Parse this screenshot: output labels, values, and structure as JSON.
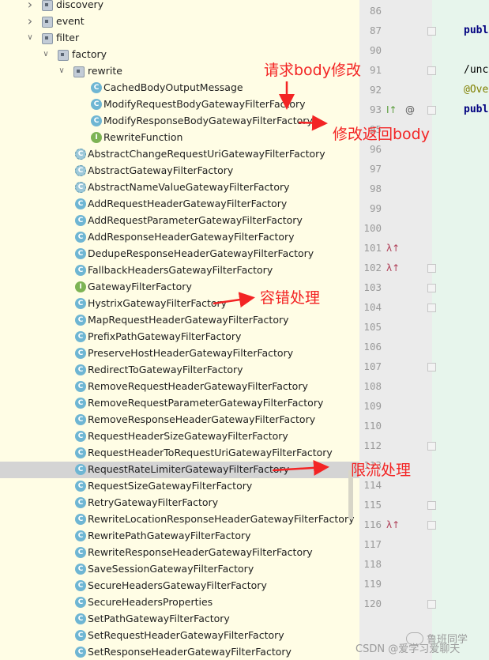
{
  "tree": {
    "items": [
      {
        "label": "discovery",
        "kind": "folder",
        "expanded": false
      },
      {
        "label": "event",
        "kind": "folder",
        "expanded": false
      },
      {
        "label": "filter",
        "kind": "folder",
        "expanded": true
      },
      {
        "label": "factory",
        "kind": "folder",
        "expanded": true
      },
      {
        "label": "rewrite",
        "kind": "folder",
        "expanded": true
      },
      {
        "label": "CachedBodyOutputMessage",
        "kind": "class"
      },
      {
        "label": "ModifyRequestBodyGatewayFilterFactory",
        "kind": "class"
      },
      {
        "label": "ModifyResponseBodyGatewayFilterFactory",
        "kind": "class"
      },
      {
        "label": "RewriteFunction",
        "kind": "interface"
      },
      {
        "label": "AbstractChangeRequestUriGatewayFilterFactory",
        "kind": "abstract"
      },
      {
        "label": "AbstractGatewayFilterFactory",
        "kind": "abstract"
      },
      {
        "label": "AbstractNameValueGatewayFilterFactory",
        "kind": "abstract"
      },
      {
        "label": "AddRequestHeaderGatewayFilterFactory",
        "kind": "class"
      },
      {
        "label": "AddRequestParameterGatewayFilterFactory",
        "kind": "class"
      },
      {
        "label": "AddResponseHeaderGatewayFilterFactory",
        "kind": "class"
      },
      {
        "label": "DedupeResponseHeaderGatewayFilterFactory",
        "kind": "class"
      },
      {
        "label": "FallbackHeadersGatewayFilterFactory",
        "kind": "class"
      },
      {
        "label": "GatewayFilterFactory",
        "kind": "interface"
      },
      {
        "label": "HystrixGatewayFilterFactory",
        "kind": "class"
      },
      {
        "label": "MapRequestHeaderGatewayFilterFactory",
        "kind": "class"
      },
      {
        "label": "PrefixPathGatewayFilterFactory",
        "kind": "class"
      },
      {
        "label": "PreserveHostHeaderGatewayFilterFactory",
        "kind": "class"
      },
      {
        "label": "RedirectToGatewayFilterFactory",
        "kind": "class"
      },
      {
        "label": "RemoveRequestHeaderGatewayFilterFactory",
        "kind": "class"
      },
      {
        "label": "RemoveRequestParameterGatewayFilterFactory",
        "kind": "class"
      },
      {
        "label": "RemoveResponseHeaderGatewayFilterFactory",
        "kind": "class"
      },
      {
        "label": "RequestHeaderSizeGatewayFilterFactory",
        "kind": "class"
      },
      {
        "label": "RequestHeaderToRequestUriGatewayFilterFactory",
        "kind": "class"
      },
      {
        "label": "RequestRateLimiterGatewayFilterFactory",
        "kind": "class",
        "selected": true
      },
      {
        "label": "RequestSizeGatewayFilterFactory",
        "kind": "class"
      },
      {
        "label": "RetryGatewayFilterFactory",
        "kind": "class"
      },
      {
        "label": "RewriteLocationResponseHeaderGatewayFilterFactory",
        "kind": "class"
      },
      {
        "label": "RewritePathGatewayFilterFactory",
        "kind": "class"
      },
      {
        "label": "RewriteResponseHeaderGatewayFilterFactory",
        "kind": "class"
      },
      {
        "label": "SaveSessionGatewayFilterFactory",
        "kind": "class"
      },
      {
        "label": "SecureHeadersGatewayFilterFactory",
        "kind": "class"
      },
      {
        "label": "SecureHeadersProperties",
        "kind": "class"
      },
      {
        "label": "SetPathGatewayFilterFactory",
        "kind": "class"
      },
      {
        "label": "SetRequestHeaderGatewayFilterFactory",
        "kind": "class"
      },
      {
        "label": "SetResponseHeaderGatewayFilterFactory",
        "kind": "class"
      }
    ]
  },
  "editor": {
    "line_numbers": [
      "86",
      "87",
      "90",
      "91",
      "92",
      "93",
      "95",
      "96",
      "97",
      "98",
      "99",
      "100",
      "101",
      "102",
      "103",
      "104",
      "105",
      "106",
      "107",
      "108",
      "109",
      "110",
      "112",
      "113",
      "114",
      "115",
      "116",
      "117",
      "118",
      "119",
      "120"
    ],
    "code_lines": [
      {
        "line": "87",
        "text": "publ",
        "style": "kw"
      },
      {
        "line": "91",
        "text": "/unc",
        "style": "plain"
      },
      {
        "line": "92",
        "text": "@Ove",
        "style": "ann"
      },
      {
        "line": "93",
        "text": "publ",
        "style": "kw"
      }
    ],
    "gutter_marks": {
      "line_93": [
        "I↑",
        "@"
      ],
      "line_101": "λ↑",
      "line_102": "λ↑",
      "line_116": "λ↑"
    }
  },
  "annotations": {
    "request_body": "请求body修改",
    "response_body": "修改返回body",
    "fault_tolerance": "容错处理",
    "rate_limit": "限流处理"
  },
  "colors": {
    "tree_background": "#FFFDE5",
    "selected_row": "#D4D4D4",
    "annotation": "#F32424",
    "class_icon": "#6FB6D3",
    "interface_icon": "#7DB354"
  },
  "watermark": "CSDN @爱学习爱聊天",
  "watermark_logo_text": "鲁班同学"
}
